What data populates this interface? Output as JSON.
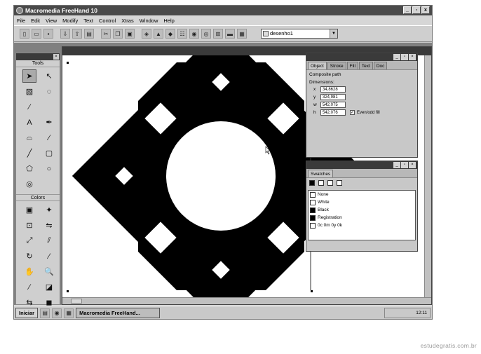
{
  "window": {
    "title": "Macromedia FreeHand 10",
    "controls": [
      "_",
      "▫",
      "x"
    ]
  },
  "menu": [
    "File",
    "Edit",
    "View",
    "Modify",
    "Text",
    "Control",
    "Xtras",
    "Window",
    "Help"
  ],
  "toolbar": {
    "document_select": "desenho1"
  },
  "tools_panel": {
    "title": "Tools",
    "colors_title": "Colors"
  },
  "object_panel": {
    "tabs": [
      "Object",
      "Stroke",
      "Fill",
      "Text",
      "Doc"
    ],
    "type": "Composite path",
    "dimensions_label": "Dimensions:",
    "fields": [
      {
        "label": "x",
        "value": "34,8628"
      },
      {
        "label": "y",
        "value": "324,981"
      },
      {
        "label": "w",
        "value": "542,075"
      },
      {
        "label": "h",
        "value": "542,076"
      }
    ],
    "even_odd_label": "Even/odd fill"
  },
  "swatches_panel": {
    "tab": "Swatches",
    "items": [
      {
        "name": "None",
        "color": "#ffffff"
      },
      {
        "name": "White",
        "color": "#ffffff"
      },
      {
        "name": "Black",
        "color": "#000000"
      },
      {
        "name": "Registration",
        "color": "#000000"
      },
      {
        "name": "0c 0m 0y 0k",
        "color": "#ffffff"
      }
    ]
  },
  "taskbar": {
    "start": "Iniciar",
    "app_task": "Macromedia FreeHand...",
    "clock": "12:11"
  },
  "watermark": "estudegratis.com.br"
}
